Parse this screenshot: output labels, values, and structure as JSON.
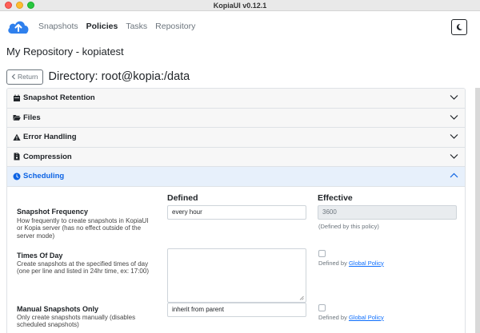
{
  "window": {
    "title": "KopiaUI v0.12.1"
  },
  "nav": {
    "items": [
      {
        "label": "Snapshots",
        "active": false
      },
      {
        "label": "Policies",
        "active": true
      },
      {
        "label": "Tasks",
        "active": false
      },
      {
        "label": "Repository",
        "active": false
      }
    ],
    "theme_icon": "moon-icon"
  },
  "repo_title": "My Repository - kopiatest",
  "return_label": "Return",
  "directory_title": "Directory: root@kopia:/data",
  "sections": [
    {
      "label": "Snapshot Retention",
      "icon": "calendar-icon",
      "open": false
    },
    {
      "label": "Files",
      "icon": "folder-open-icon",
      "open": false
    },
    {
      "label": "Error Handling",
      "icon": "warning-icon",
      "open": false
    },
    {
      "label": "Compression",
      "icon": "file-zip-icon",
      "open": false
    },
    {
      "label": "Scheduling",
      "icon": "clock-icon",
      "open": true
    }
  ],
  "scheduling": {
    "col_defined": "Defined",
    "col_effective": "Effective",
    "rows": [
      {
        "title": "Snapshot Frequency",
        "desc": "How frequently to create snapshots in KopiaUI or Kopia server (has no effect outside of the server mode)",
        "defined_value": "every hour",
        "effective_value": "3600",
        "effective_hint": "(Defined by this policy)"
      },
      {
        "title": "Times Of Day",
        "desc": "Create snapshots at the specified times of day (one per line and listed in 24hr time, ex: 17:00)",
        "defined_value": "",
        "hint_prefix": "Defined by ",
        "hint_link": "Global Policy"
      },
      {
        "title": "Manual Snapshots Only",
        "desc": "Only create snapshots manually (disables scheduled snapshots)",
        "defined_value": "inherit from parent",
        "hint_prefix": "Defined by ",
        "hint_link": "Global Policy"
      }
    ]
  },
  "colors": {
    "accent": "#0c63e4",
    "open_header_bg": "#e7f0fb",
    "logo": "#2f80ed"
  }
}
